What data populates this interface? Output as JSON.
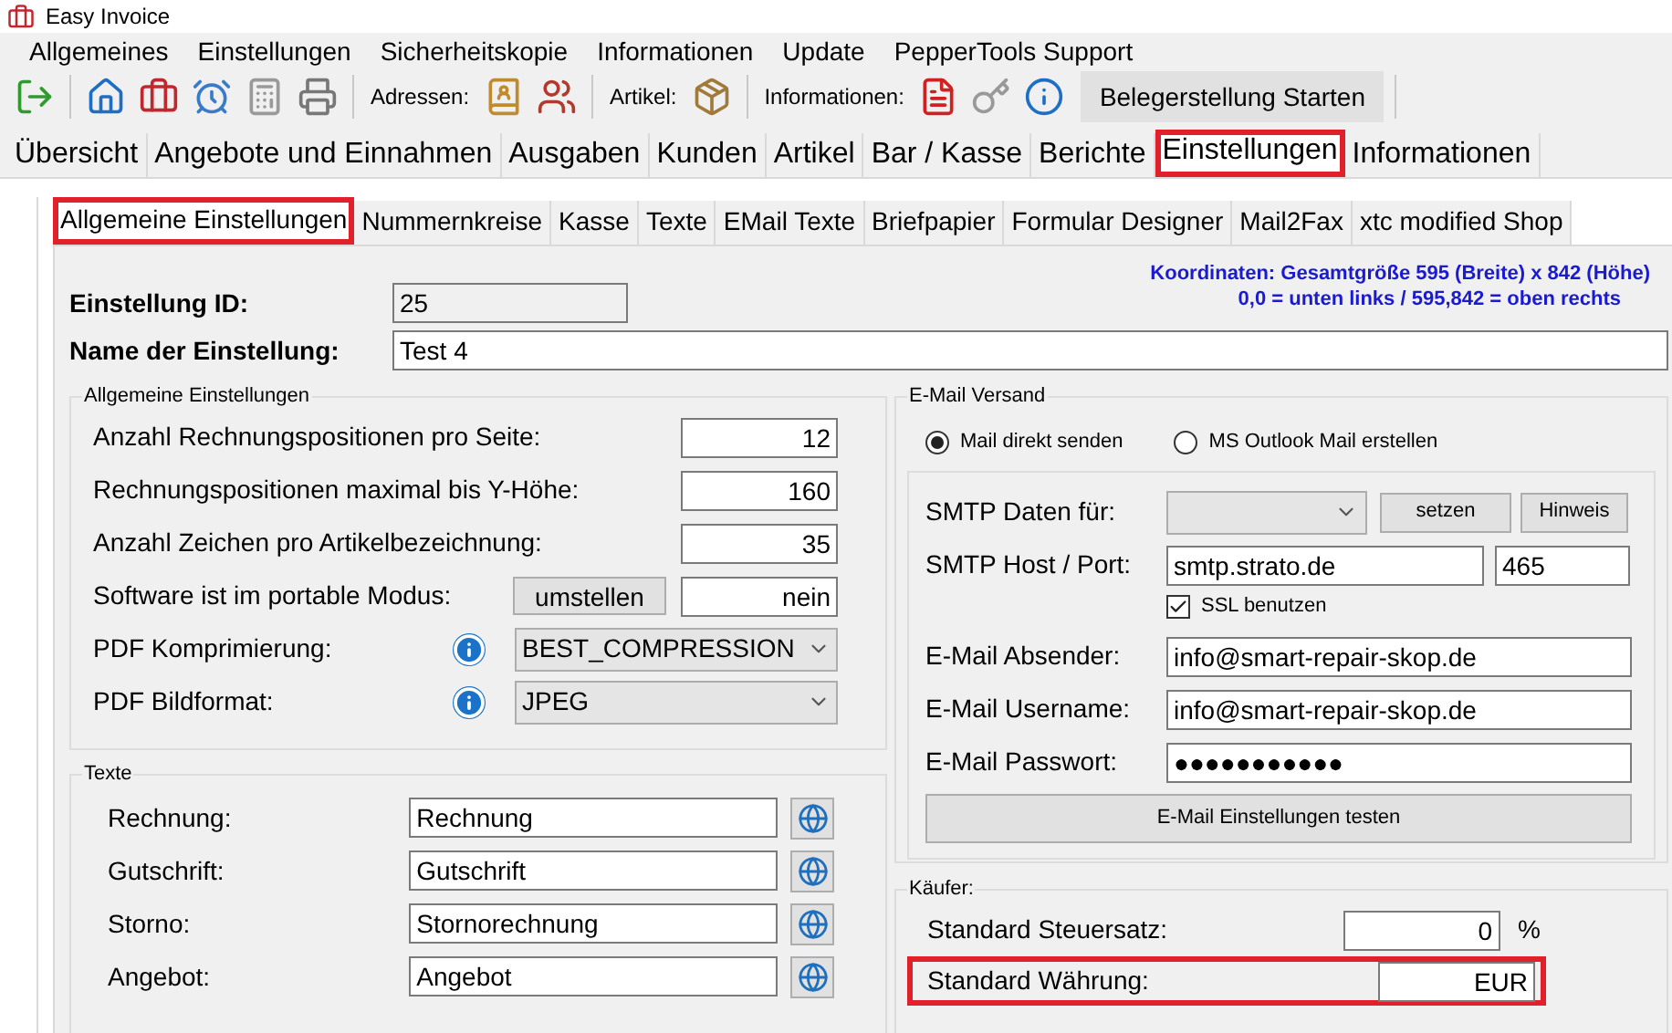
{
  "window": {
    "title": "Easy Invoice"
  },
  "menu": [
    "Allgemeines",
    "Einstellungen",
    "Sicherheitskopie",
    "Informationen",
    "Update",
    "PepperTools Support"
  ],
  "toolbar": {
    "address_label": "Adressen:",
    "article_label": "Artikel:",
    "info_label": "Informationen:",
    "start_button": "Belegerstellung Starten"
  },
  "tabs": [
    {
      "label": "Übersicht",
      "selected": false,
      "highlighted": false
    },
    {
      "label": "Angebote und Einnahmen",
      "selected": false,
      "highlighted": false
    },
    {
      "label": "Ausgaben",
      "selected": false,
      "highlighted": false
    },
    {
      "label": "Kunden",
      "selected": false,
      "highlighted": false
    },
    {
      "label": "Artikel",
      "selected": false,
      "highlighted": false
    },
    {
      "label": "Bar / Kasse",
      "selected": false,
      "highlighted": false
    },
    {
      "label": "Berichte",
      "selected": false,
      "highlighted": false
    },
    {
      "label": "Einstellungen",
      "selected": true,
      "highlighted": true
    },
    {
      "label": "Informationen",
      "selected": false,
      "highlighted": false
    }
  ],
  "subtabs": [
    {
      "label": "Allgemeine Einstellungen",
      "selected": true,
      "highlighted": true
    },
    {
      "label": "Nummernkreise",
      "selected": false,
      "highlighted": false
    },
    {
      "label": "Kasse",
      "selected": false,
      "highlighted": false
    },
    {
      "label": "Texte",
      "selected": false,
      "highlighted": false
    },
    {
      "label": "EMail Texte",
      "selected": false,
      "highlighted": false
    },
    {
      "label": "Briefpapier",
      "selected": false,
      "highlighted": false
    },
    {
      "label": "Formular Designer",
      "selected": false,
      "highlighted": false
    },
    {
      "label": "Mail2Fax",
      "selected": false,
      "highlighted": false
    },
    {
      "label": "xtc modified Shop",
      "selected": false,
      "highlighted": false
    }
  ],
  "settings": {
    "id_label": "Einstellung ID:",
    "id_value": "25",
    "name_label": "Name der Einstellung:",
    "name_value": "Test 4",
    "coords_note": [
      "Koordinaten: Gesamtgröße 595 (Breite) x 842 (Höhe)",
      "0,0 = unten links / 595,842 = oben rechts"
    ]
  },
  "general": {
    "title": "Allgemeine Einstellungen",
    "rows": [
      {
        "kind": "number",
        "label": "Anzahl Rechnungspositionen pro Seite:",
        "value": "12"
      },
      {
        "kind": "number",
        "label": "Rechnungspositionen maximal bis Y-Höhe:",
        "value": "160"
      },
      {
        "kind": "number",
        "label": "Anzahl Zeichen pro Artikelbezeichnung:",
        "value": "35"
      },
      {
        "kind": "toggle",
        "label": "Software ist im portable Modus:",
        "button": "umstellen",
        "value": "nein"
      },
      {
        "kind": "select",
        "label": "PDF Komprimierung:",
        "value": "BEST_COMPRESSION"
      },
      {
        "kind": "select",
        "label": "PDF Bildformat:",
        "value": "JPEG"
      }
    ]
  },
  "texts": {
    "title": "Texte",
    "rows": [
      {
        "label": "Rechnung:",
        "value": "Rechnung"
      },
      {
        "label": "Gutschrift:",
        "value": "Gutschrift"
      },
      {
        "label": "Storno:",
        "value": "Stornorechnung"
      },
      {
        "label": "Angebot:",
        "value": "Angebot"
      }
    ]
  },
  "email": {
    "title": "E-Mail Versand",
    "modes": [
      {
        "label": "Mail direkt senden",
        "selected": true
      },
      {
        "label": "MS Outlook Mail erstellen",
        "selected": false
      }
    ],
    "smtp_data_label": "SMTP Daten für:",
    "set_button": "setzen",
    "hint_button": "Hinweis",
    "host_label": "SMTP Host / Port:",
    "host": "smtp.strato.de",
    "port": "465",
    "ssl": {
      "label": "SSL benutzen",
      "checked": true
    },
    "sender_label": "E-Mail Absender:",
    "sender": "info@smart-repair-skop.de",
    "user_label": "E-Mail Username:",
    "user": "info@smart-repair-skop.de",
    "password_label": "E-Mail Passwort:",
    "password": "●●●●●●●●●●●",
    "test_button": "E-Mail Einstellungen testen"
  },
  "buyer": {
    "title": "Käufer:",
    "rows": [
      {
        "label": "Standard Steuersatz:",
        "value": "0",
        "unit": "%",
        "highlighted": false
      },
      {
        "label": "Standard Währung:",
        "value": "EUR",
        "highlighted": true
      }
    ]
  }
}
